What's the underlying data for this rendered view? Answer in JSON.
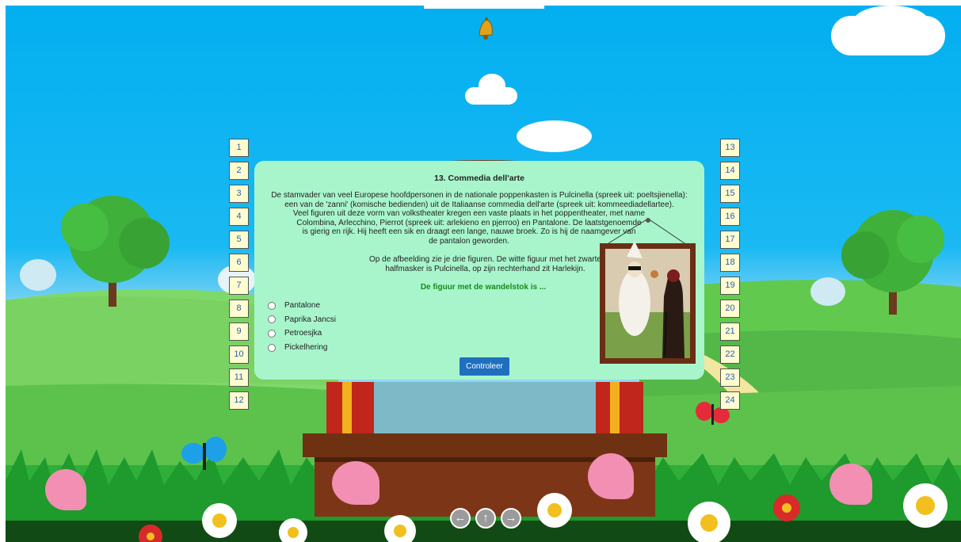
{
  "question": {
    "title": "13. Commedia dell'arte",
    "paragraph1": [
      "De stamvader van veel Europese hoofdpersonen in de nationale poppenkasten is Pulcinella (spreek uit: poeltsjienella):",
      "een van de 'zanni' (komische bedienden) uit de Italiaanse commedia dell'arte (spreek uit: kommeediadellartee).",
      "Veel figuren uit deze vorm van volkstheater kregen een vaste plaats in het poppentheater, met name",
      "Colombina, Arlecchino, Pierrot (spreek uit: arlekieno en pjerroo) en Pantalone. De laatstgenoemde",
      "is gierig en rijk. Hij heeft een sik en draagt een lange, nauwe broek. Zo is hij de naamgever van",
      "de pantalon geworden."
    ],
    "paragraph2": [
      "Op de afbeelding zie je drie figuren. De witte figuur met het zwarte",
      "halfmasker is Pulcinella, op zijn rechterhand zit Harlekijn."
    ],
    "prompt": "De figuur met de wandelstok is ...",
    "options": [
      "Pantalone",
      "Paprika Jancsi",
      "Petroesjka",
      "Pickelhering"
    ],
    "check_label": "Controleer"
  },
  "left_numbers": [
    "1",
    "2",
    "3",
    "4",
    "5",
    "6",
    "7",
    "8",
    "9",
    "10",
    "11",
    "12"
  ],
  "right_numbers": [
    "13",
    "14",
    "15",
    "16",
    "17",
    "18",
    "19",
    "20",
    "21",
    "22",
    "23",
    "24"
  ],
  "nav": {
    "prev_icon": "arrow-left-icon",
    "up_icon": "arrow-up-icon",
    "next_icon": "arrow-right-icon"
  },
  "colors": {
    "panel": "#a8f5cc",
    "prompt": "#1a8a1a",
    "button": "#1f6fbf",
    "number_bg": "#fffdd0",
    "number_text": "#2a5db0"
  }
}
